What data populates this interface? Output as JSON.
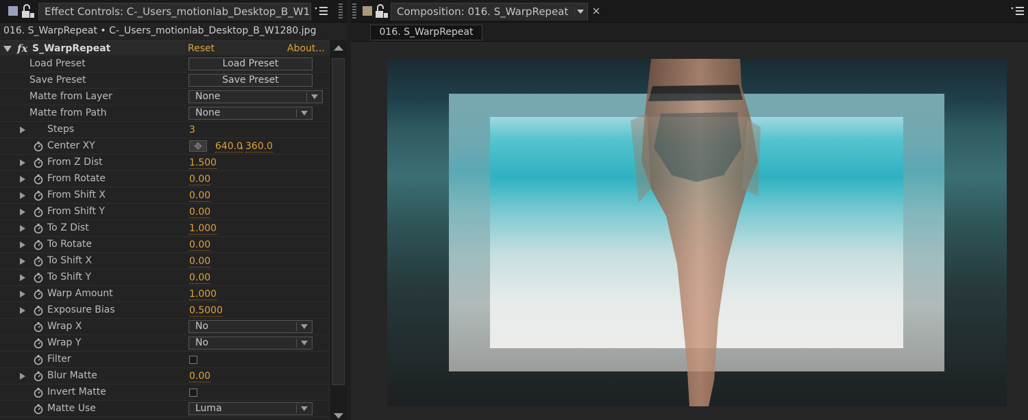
{
  "left_panel": {
    "tab_title": "Effect Controls: C-_Users_motionlab_Desktop_B_W1",
    "breadcrumb": "016. S_WarpRepeat • C-_Users_motionlab_Desktop_B_W1280.jpg",
    "effect": {
      "fx_badge": "fx",
      "name": "S_WarpRepeat",
      "reset_label": "Reset",
      "about_label": "About..."
    },
    "properties": [
      {
        "label": "Load Preset",
        "button": "Load Preset"
      },
      {
        "label": "Save Preset",
        "button": "Save Preset"
      },
      {
        "label": "Matte from Layer",
        "dropdown": "None"
      },
      {
        "label": "Matte from Path",
        "dropdown": "None"
      },
      {
        "label": "Steps",
        "value": "3"
      },
      {
        "label": "Center XY",
        "value_x": "640.0",
        "value_y": "360.0"
      },
      {
        "label": "From Z Dist",
        "value": "1.500"
      },
      {
        "label": "From Rotate",
        "value": "0.00"
      },
      {
        "label": "From Shift X",
        "value": "0.00"
      },
      {
        "label": "From Shift Y",
        "value": "0.00"
      },
      {
        "label": "To Z Dist",
        "value": "1.000"
      },
      {
        "label": "To Rotate",
        "value": "0.00"
      },
      {
        "label": "To Shift X",
        "value": "0.00"
      },
      {
        "label": "To Shift Y",
        "value": "0.00"
      },
      {
        "label": "Warp Amount",
        "value": "1.000"
      },
      {
        "label": "Exposure Bias",
        "value": "0.5000"
      },
      {
        "label": "Wrap X",
        "dropdown": "No"
      },
      {
        "label": "Wrap Y",
        "dropdown": "No"
      },
      {
        "label": "Filter",
        "checked": false
      },
      {
        "label": "Blur Matte",
        "value": "0.00"
      },
      {
        "label": "Invert Matte",
        "checked": false
      },
      {
        "label": "Matte Use",
        "dropdown": "Luma"
      }
    ]
  },
  "right_panel": {
    "tab_title": "Composition: 016. S_WarpRepeat",
    "sub_tab": "016. S_WarpRepeat"
  },
  "colors": {
    "accent_value": "#e0a13a",
    "panel_bg": "#232323",
    "tabbar_bg": "#191919"
  },
  "icons": [
    "lock-icon",
    "panel-menu-icon",
    "twirl-triangle-icon",
    "stopwatch-icon",
    "crosshair-icon",
    "dropdown-arrow-icon",
    "close-icon"
  ]
}
